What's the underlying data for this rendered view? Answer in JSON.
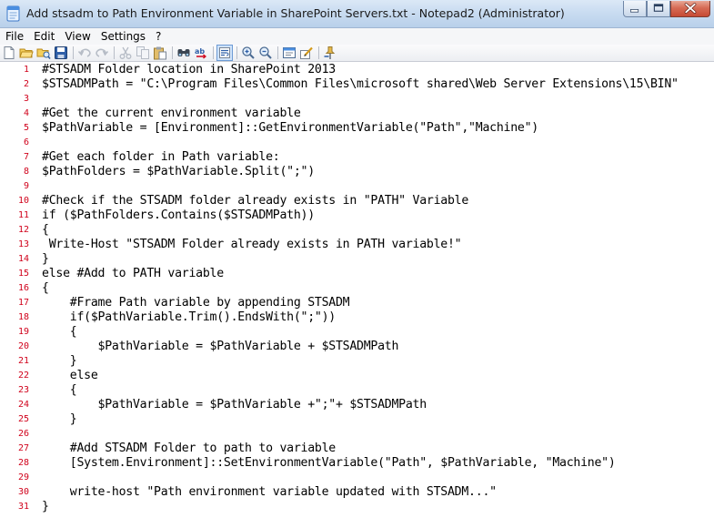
{
  "window": {
    "title": "Add stsadm to Path Environment Variable in SharePoint Servers.txt - Notepad2 (Administrator)",
    "buttons": [
      "minimize-button",
      "maximize-button",
      "close-button"
    ]
  },
  "menu": {
    "items": [
      "File",
      "Edit",
      "View",
      "Settings",
      "?"
    ]
  },
  "toolbar": {
    "icons": [
      "new-icon",
      "open-icon",
      "browse-icon",
      "save-icon",
      "undo-icon",
      "redo-icon",
      "cut-icon",
      "copy-icon",
      "paste-icon",
      "find-icon",
      "replace-icon",
      "word-wrap-icon",
      "zoom-in-icon",
      "zoom-out-icon",
      "select-scheme-icon",
      "customize-schemes-icon",
      "always-on-top-icon"
    ]
  },
  "editor": {
    "line_number_color": "#d0021b",
    "lines": [
      {
        "n": "1",
        "text": "#STSADM Folder location in SharePoint 2013"
      },
      {
        "n": "2",
        "text": "$STSADMPath = \"C:\\Program Files\\Common Files\\microsoft shared\\Web Server Extensions\\15\\BIN\""
      },
      {
        "n": "3",
        "text": ""
      },
      {
        "n": "4",
        "text": "#Get the current environment variable"
      },
      {
        "n": "5",
        "text": "$PathVariable = [Environment]::GetEnvironmentVariable(\"Path\",\"Machine\")"
      },
      {
        "n": "6",
        "text": ""
      },
      {
        "n": "7",
        "text": "#Get each folder in Path variable:"
      },
      {
        "n": "8",
        "text": "$PathFolders = $PathVariable.Split(\";\")"
      },
      {
        "n": "9",
        "text": ""
      },
      {
        "n": "10",
        "text": "#Check if the STSADM folder already exists in \"PATH\" Variable"
      },
      {
        "n": "11",
        "text": "if ($PathFolders.Contains($STSADMPath))"
      },
      {
        "n": "12",
        "text": "{"
      },
      {
        "n": "13",
        "text": " Write-Host \"STSADM Folder already exists in PATH variable!\""
      },
      {
        "n": "14",
        "text": "}"
      },
      {
        "n": "15",
        "text": "else #Add to PATH variable"
      },
      {
        "n": "16",
        "text": "{"
      },
      {
        "n": "17",
        "text": "    #Frame Path variable by appending STSADM"
      },
      {
        "n": "18",
        "text": "    if($PathVariable.Trim().EndsWith(\";\"))"
      },
      {
        "n": "19",
        "text": "    {"
      },
      {
        "n": "20",
        "text": "        $PathVariable = $PathVariable + $STSADMPath"
      },
      {
        "n": "21",
        "text": "    }"
      },
      {
        "n": "22",
        "text": "    else"
      },
      {
        "n": "23",
        "text": "    {"
      },
      {
        "n": "24",
        "text": "        $PathVariable = $PathVariable +\";\"+ $STSADMPath"
      },
      {
        "n": "25",
        "text": "    }"
      },
      {
        "n": "26",
        "text": ""
      },
      {
        "n": "27",
        "text": "    #Add STSADM Folder to path to variable"
      },
      {
        "n": "28",
        "text": "    [System.Environment]::SetEnvironmentVariable(\"Path\", $PathVariable, \"Machine\")"
      },
      {
        "n": "29",
        "text": ""
      },
      {
        "n": "30",
        "text": "    write-host \"Path environment variable updated with STSADM...\""
      },
      {
        "n": "31",
        "text": "}"
      }
    ]
  }
}
